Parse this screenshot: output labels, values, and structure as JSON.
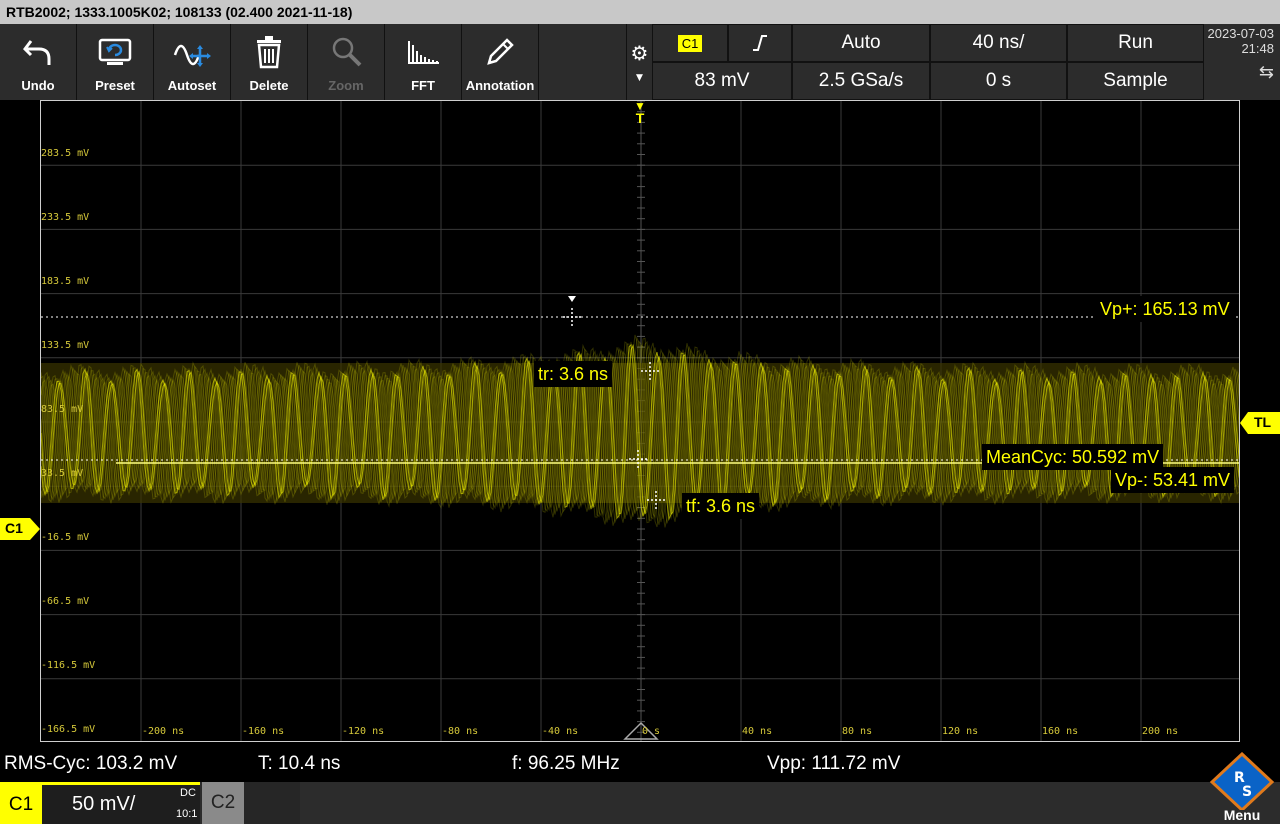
{
  "title": "RTB2002; 1333.1005K02; 108133 (02.400 2021-11-18)",
  "toolbar": {
    "undo": "Undo",
    "preset": "Preset",
    "autoset": "Autoset",
    "delete": "Delete",
    "zoom": "Zoom",
    "fft": "FFT",
    "annotation": "Annotation"
  },
  "trigger": {
    "channel": "C1",
    "mode": "Auto",
    "level": "83 mV",
    "timebase": "40 ns/",
    "sample_rate": "2.5 GSa/s",
    "position": "0 s",
    "run_state": "Run",
    "acq_mode": "Sample"
  },
  "datetime": {
    "date": "2023-07-03",
    "time": "21:48"
  },
  "y_labels": [
    "283.5 mV",
    "233.5 mV",
    "183.5 mV",
    "133.5 mV",
    "83.5 mV",
    "33.5 mV",
    "-16.5 mV",
    "-66.5 mV",
    "-116.5 mV",
    "-166.5 mV"
  ],
  "x_labels": [
    "-200 ns",
    "-160 ns",
    "-120 ns",
    "-80 ns",
    "-40 ns",
    "0 s",
    "40 ns",
    "80 ns",
    "120 ns",
    "160 ns",
    "200 ns"
  ],
  "markers": {
    "trigger_top": "T",
    "trigger_level": "TL",
    "channel": "C1"
  },
  "measurements": {
    "vp_plus": "Vp+: 165.13 mV",
    "tr": "tr: 3.6 ns",
    "meancyc": "MeanCyc: 50.592 mV",
    "vp_minus": "Vp-: 53.41 mV",
    "tf": "tf: 3.6 ns"
  },
  "bottom": {
    "rms": "RMS-Cyc: 103.2 mV",
    "period": "T: 10.4 ns",
    "freq": "f: 96.25 MHz",
    "vpp": "Vpp: 111.72 mV"
  },
  "channels": {
    "c1_label": "C1",
    "c1_scale": "50 mV/",
    "c1_coupling": "DC",
    "c1_probe": "10:1",
    "c2_label": "C2"
  },
  "menu": "Menu",
  "colors": {
    "trace": "#ffff00",
    "toolbar": "#2c2c2c",
    "grid": "#3a3a3a"
  }
}
